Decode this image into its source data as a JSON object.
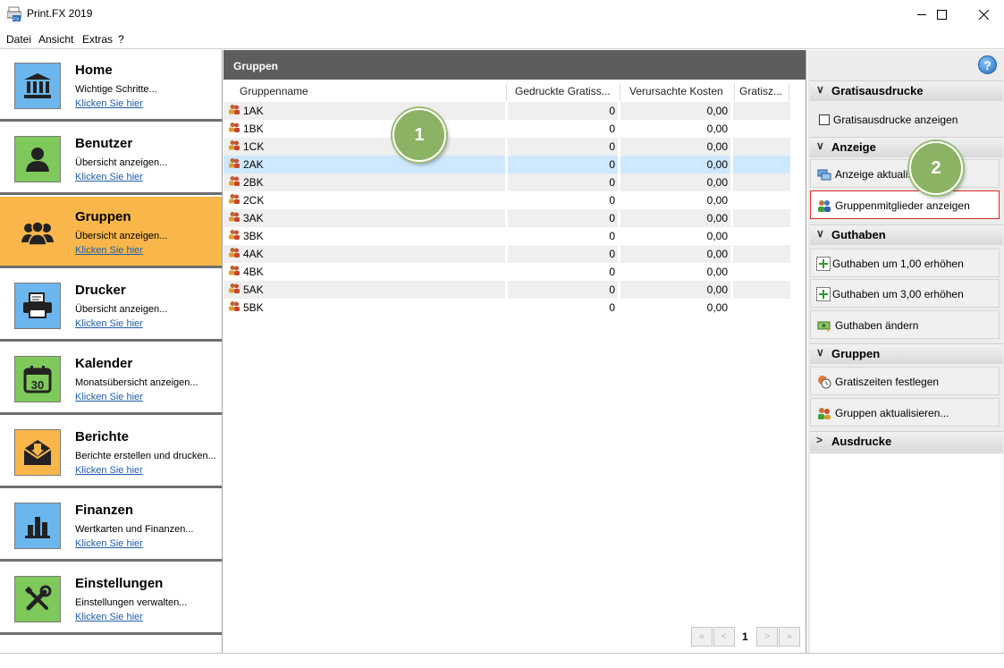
{
  "window": {
    "title": "Print.FX 2019"
  },
  "menu": [
    "Datei",
    "Ansicht",
    "Extras",
    "?"
  ],
  "sidebar": {
    "items": [
      {
        "title": "Home",
        "desc": "Wichtige Schritte...",
        "link": "Klicken Sie hier",
        "icon": "bank-icon",
        "color": "#6cb6ee"
      },
      {
        "title": "Benutzer",
        "desc": "Übersicht anzeigen...",
        "link": "Klicken Sie hier",
        "icon": "user-icon",
        "color": "#7ec95a"
      },
      {
        "title": "Gruppen",
        "desc": "Übersicht anzeigen...",
        "link": "Klicken Sie hier",
        "icon": "group-icon",
        "color": "#f9b64a"
      },
      {
        "title": "Drucker",
        "desc": "Übersicht anzeigen...",
        "link": "Klicken Sie hier",
        "icon": "printer-icon",
        "color": "#6cb6ee"
      },
      {
        "title": "Kalender",
        "desc": "Monatsübersicht anzeigen...",
        "link": "Klicken Sie hier",
        "icon": "calendar-icon",
        "color": "#7ec95a"
      },
      {
        "title": "Berichte",
        "desc": "Berichte erstellen und drucken...",
        "link": "Klicken Sie hier",
        "icon": "report-icon",
        "color": "#f9b64a"
      },
      {
        "title": "Finanzen",
        "desc": "Wertkarten und Finanzen...",
        "link": "Klicken Sie hier",
        "icon": "finance-chart-icon",
        "color": "#6cb6ee"
      },
      {
        "title": "Einstellungen",
        "desc": "Einstellungen verwalten...",
        "link": "Klicken Sie hier",
        "icon": "tools-icon",
        "color": "#7ec95a"
      }
    ],
    "active_index": 2
  },
  "center": {
    "header": "Gruppen",
    "columns": [
      "Gruppenname",
      "Gedruckte Gratiss...",
      "Verursachte Kosten",
      "Gratisz..."
    ],
    "rows": [
      {
        "name": "1AK",
        "printed": "0",
        "cost": "0,00"
      },
      {
        "name": "1BK",
        "printed": "0",
        "cost": "0,00"
      },
      {
        "name": "1CK",
        "printed": "0",
        "cost": "0,00"
      },
      {
        "name": "2AK",
        "printed": "0",
        "cost": "0,00"
      },
      {
        "name": "2BK",
        "printed": "0",
        "cost": "0,00"
      },
      {
        "name": "2CK",
        "printed": "0",
        "cost": "0,00"
      },
      {
        "name": "3AK",
        "printed": "0",
        "cost": "0,00"
      },
      {
        "name": "3BK",
        "printed": "0",
        "cost": "0,00"
      },
      {
        "name": "4AK",
        "printed": "0",
        "cost": "0,00"
      },
      {
        "name": "4BK",
        "printed": "0",
        "cost": "0,00"
      },
      {
        "name": "5AK",
        "printed": "0",
        "cost": "0,00"
      },
      {
        "name": "5BK",
        "printed": "0",
        "cost": "0,00"
      }
    ],
    "selected_row": 3,
    "pagination": {
      "first": "«",
      "prev": "<",
      "page": "1",
      "next": ">",
      "last": "»"
    }
  },
  "right": {
    "help_icon": "?",
    "sections": {
      "gratis": {
        "title": "Gratisausdrucke",
        "checkbox_label": "Gratisausdrucke anzeigen"
      },
      "anzeige": {
        "title": "Anzeige",
        "refresh": "Anzeige aktualisieren",
        "members": "Gruppenmitglieder anzeigen"
      },
      "guthaben": {
        "title": "Guthaben",
        "plus1": "Guthaben um 1,00 erhöhen",
        "plus3": "Guthaben um 3,00 erhöhen",
        "change": "Guthaben ändern"
      },
      "gruppen": {
        "title": "Gruppen",
        "freetimes": "Gratiszeiten festlegen",
        "update": "Gruppen aktualisieren..."
      },
      "ausdrucke": {
        "title": "Ausdrucke"
      }
    }
  },
  "callouts": [
    "1",
    "2"
  ],
  "colors": {
    "active_nav": "#f9b64a",
    "header_bg": "#5d5d5d",
    "highlight_border": "#e2262b",
    "callout": "#8cb264",
    "selected_row": "#cde8ff",
    "link": "#1f5dab"
  }
}
